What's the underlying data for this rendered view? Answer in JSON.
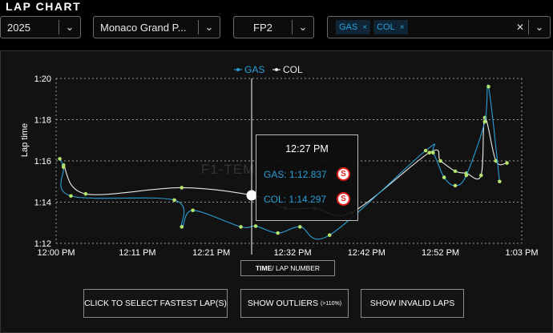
{
  "page": {
    "title": "LAP CHART"
  },
  "filters": {
    "year": "2025",
    "event": "Monaco Grand P...",
    "session": "FP2",
    "drivers": [
      {
        "label": "GAS"
      },
      {
        "label": "COL"
      }
    ],
    "clear_icon": "✕",
    "chevron_icon": "⌄"
  },
  "chart_data": {
    "type": "line",
    "ylabel": "Lap time",
    "x_ticks": [
      "12:00 PM",
      "12:11 PM",
      "12:21 PM",
      "12:32 PM",
      "12:42 PM",
      "12:52 PM",
      "1:03 PM"
    ],
    "y_ticks": [
      "1:12",
      "1:14",
      "1:16",
      "1:18",
      "1:20"
    ],
    "ylim": [
      72,
      80
    ],
    "grid": true,
    "legend_position": "top-center",
    "x_axis_mode": "TIME",
    "watermark": "F1-TEMPO.COM",
    "series": [
      {
        "name": "GAS",
        "color": "#2a9fd6",
        "points": [
          {
            "time": "12:00:30",
            "lap": 76.1
          },
          {
            "time": "12:01:00",
            "lap": 75.7
          },
          {
            "time": "12:02:00",
            "lap": 74.3
          },
          {
            "time": "12:16:00",
            "lap": 74.1
          },
          {
            "time": "12:17:00",
            "lap": 72.8
          },
          {
            "time": "12:18:30",
            "lap": 73.6
          },
          {
            "time": "12:25:00",
            "lap": 72.8
          },
          {
            "time": "12:27:00",
            "lap": 72.837
          },
          {
            "time": "12:30:00",
            "lap": 72.5
          },
          {
            "time": "12:33:00",
            "lap": 72.8
          },
          {
            "time": "12:37:00",
            "lap": 72.4
          },
          {
            "time": "12:50:00",
            "lap": 76.5
          },
          {
            "time": "12:51:00",
            "lap": 76.4
          },
          {
            "time": "12:52:30",
            "lap": 75.2
          },
          {
            "time": "12:54:00",
            "lap": 74.8
          },
          {
            "time": "12:55:30",
            "lap": 75.3
          },
          {
            "time": "12:58:00",
            "lap": 77.9
          },
          {
            "time": "12:58:30",
            "lap": 79.6
          },
          {
            "time": "13:00:00",
            "lap": 75.0
          }
        ]
      },
      {
        "name": "COL",
        "color": "#e8e8e8",
        "points": [
          {
            "time": "12:01:00",
            "lap": 75.8
          },
          {
            "time": "12:04:00",
            "lap": 74.4
          },
          {
            "time": "12:17:00",
            "lap": 74.7
          },
          {
            "time": "12:27:00",
            "lap": 74.297
          },
          {
            "time": "12:31:00",
            "lap": 73.7
          },
          {
            "time": "12:35:00",
            "lap": 73.7
          },
          {
            "time": "12:40:00",
            "lap": 73.5
          },
          {
            "time": "12:50:30",
            "lap": 76.4
          },
          {
            "time": "12:52:00",
            "lap": 76.0
          },
          {
            "time": "12:54:00",
            "lap": 75.5
          },
          {
            "time": "12:55:30",
            "lap": 75.4
          },
          {
            "time": "12:57:30",
            "lap": 75.3
          },
          {
            "time": "12:58:00",
            "lap": 78.1
          },
          {
            "time": "12:59:30",
            "lap": 76.0
          },
          {
            "time": "13:01:00",
            "lap": 75.9
          }
        ]
      }
    ]
  },
  "tooltip": {
    "time": "12:27 PM",
    "rows": [
      {
        "label": "GAS: 1:12.837",
        "tyre": "S"
      },
      {
        "label": "COL: 1:14.297",
        "tyre": "S"
      }
    ]
  },
  "x_axis_toggle": {
    "bold": "TIME",
    "rest": " / LAP NUMBER"
  },
  "buttons": {
    "fastest": "CLICK TO SELECT FASTEST LAP(S)",
    "outliers": "SHOW OUTLIERS",
    "outliers_note": "(>110%)",
    "invalid": "SHOW INVALID LAPS"
  },
  "colors": {
    "GAS": "#2a9fd6",
    "COL": "#e8e8e8",
    "marker": "#b5e26a",
    "tyre_soft": "#e0201b"
  }
}
